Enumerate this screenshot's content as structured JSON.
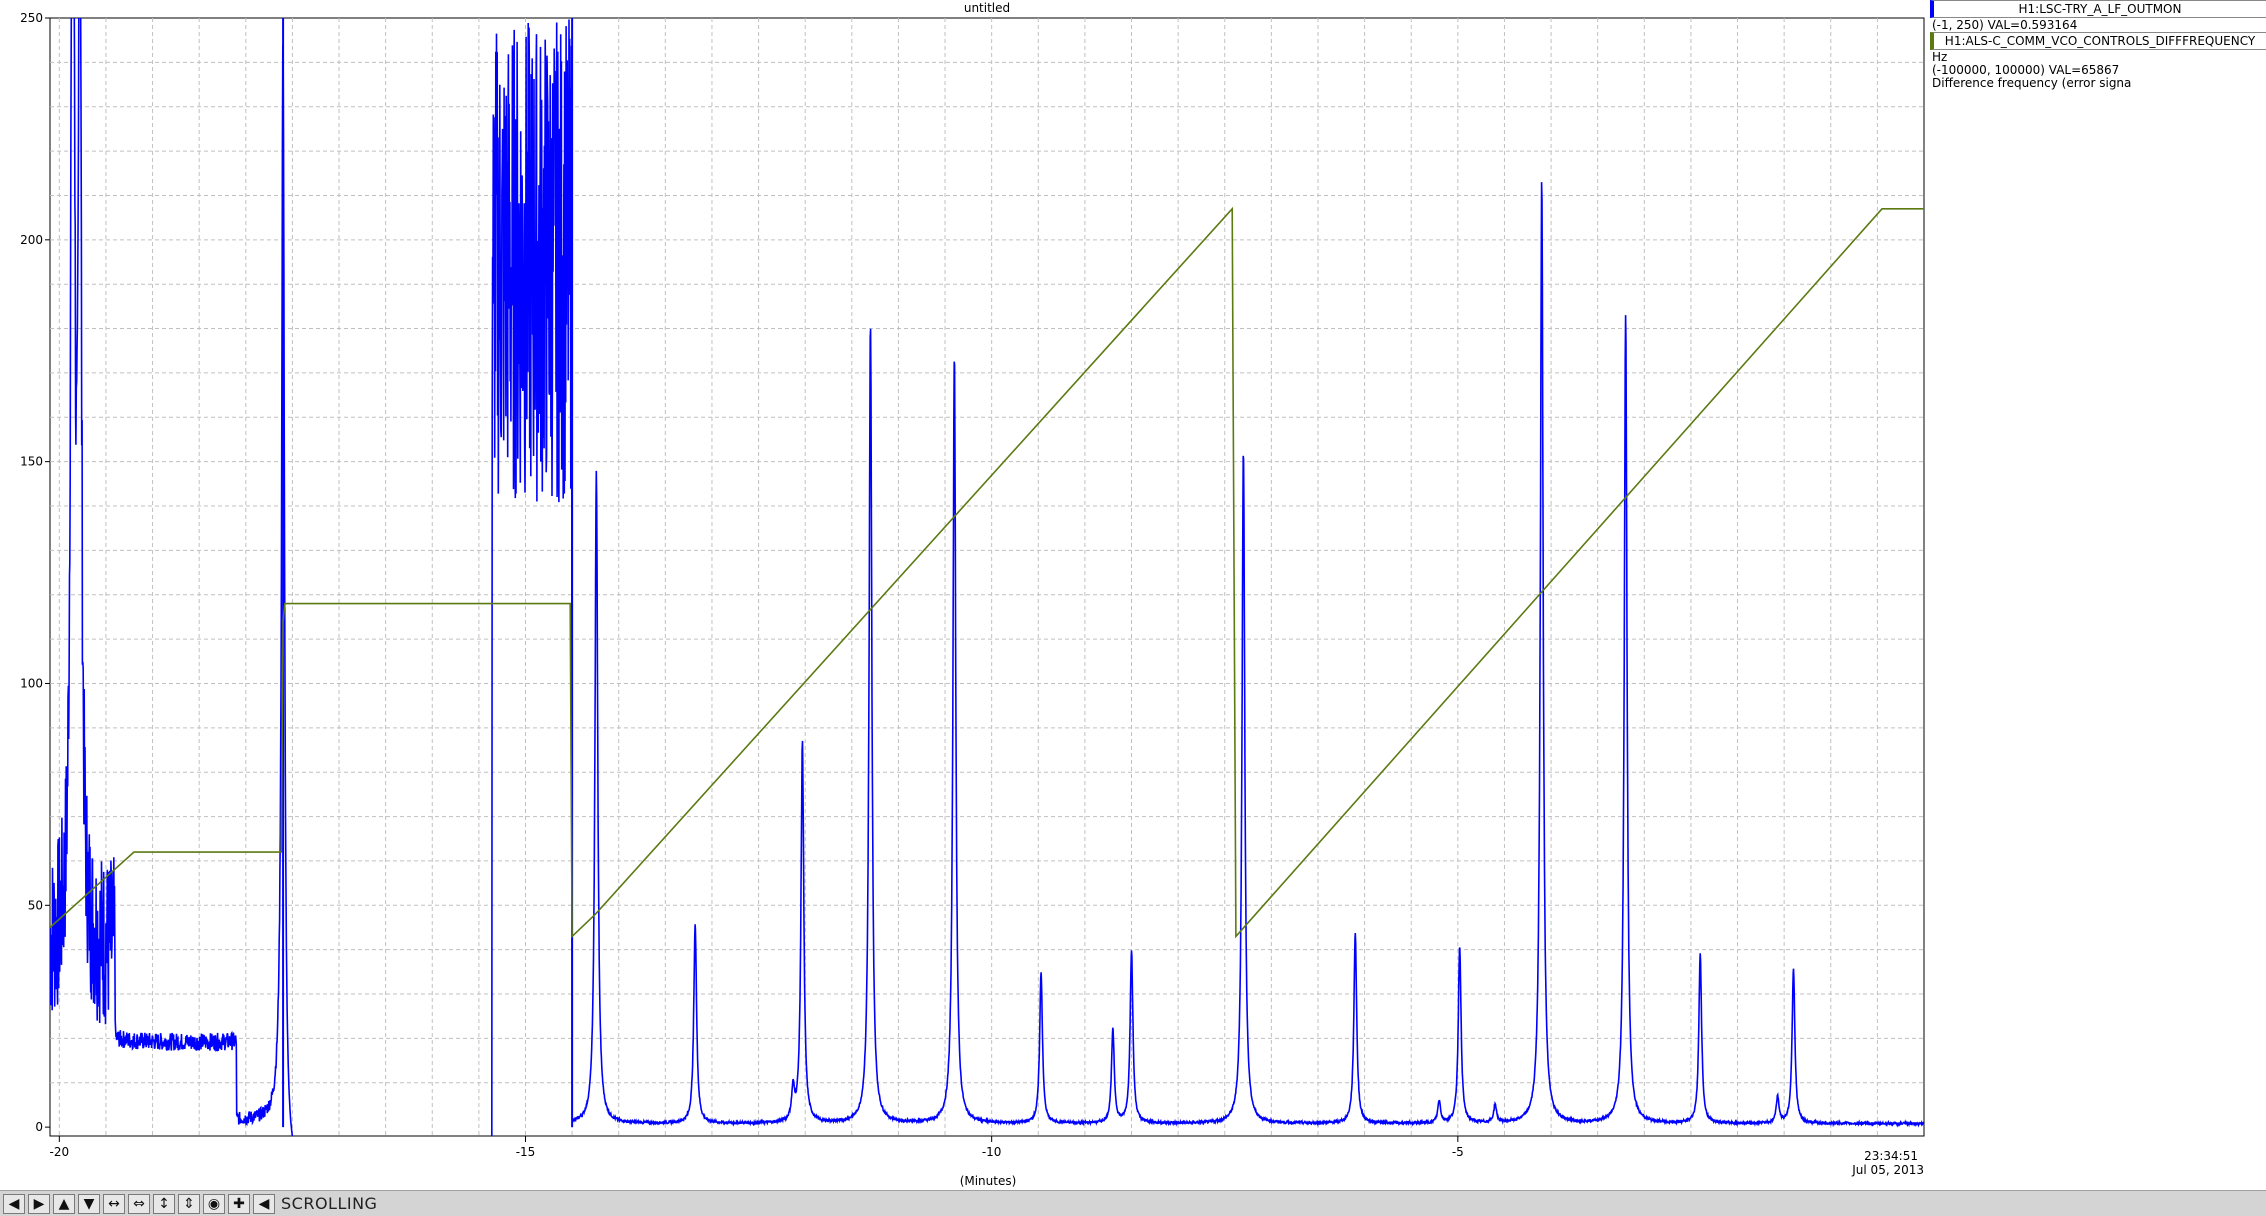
{
  "window_title": "untitled",
  "legend": {
    "series1_label": "H1:LSC-TRY_A_LF_OUTMON",
    "series1_range": "(-1, 250) VAL=0.593164",
    "series2_label": "H1:ALS-C_COMM_VCO_CONTROLS_DIFFFREQUENCY",
    "series2_unit": "Hz",
    "series2_range": "(-100000, 100000) VAL=65867",
    "series2_desc": "Difference frequency (error signa"
  },
  "timestamp": {
    "time": "23:34:51",
    "date": "Jul 05, 2013"
  },
  "toolbar": {
    "status": "SCROLLING",
    "icons": [
      "arrow-left-icon",
      "arrow-right-icon",
      "arrow-up-icon",
      "arrow-down-icon",
      "expand-horizontal-icon",
      "compress-horizontal-icon",
      "expand-vertical-icon",
      "compress-vertical-icon",
      "record-icon",
      "zoom-plus-icon",
      "back-icon"
    ]
  },
  "chart_data": {
    "type": "line",
    "title": "untitled",
    "xlabel": "(Minutes)",
    "ylabel": "",
    "xlim": [
      -20.1,
      0
    ],
    "ylim": [
      -2,
      250
    ],
    "x_ticks": [
      -20,
      -15,
      -10,
      -5
    ],
    "y_ticks": [
      0,
      50,
      100,
      150,
      200,
      250
    ],
    "grid": true,
    "colors": {
      "series1": "#0000ff",
      "series2": "#5c7a12",
      "grid": "#c0c0c0"
    },
    "series": [
      {
        "name": "H1:LSC-TRY_A_LF_OUTMON",
        "peaks": [
          {
            "x": -19.87,
            "y": 96
          },
          {
            "x": -19.85,
            "y": 250
          },
          {
            "x": -19.78,
            "y": 250
          },
          {
            "x": -17.6,
            "y": 250
          },
          {
            "x": -14.24,
            "y": 147
          },
          {
            "x": -13.18,
            "y": 45
          },
          {
            "x": -12.13,
            "y": 7
          },
          {
            "x": -12.03,
            "y": 86
          },
          {
            "x": -11.3,
            "y": 180
          },
          {
            "x": -10.4,
            "y": 173
          },
          {
            "x": -9.47,
            "y": 34
          },
          {
            "x": -8.7,
            "y": 21
          },
          {
            "x": -8.5,
            "y": 39
          },
          {
            "x": -7.3,
            "y": 152
          },
          {
            "x": -6.1,
            "y": 43
          },
          {
            "x": -5.2,
            "y": 5
          },
          {
            "x": -4.98,
            "y": 40
          },
          {
            "x": -4.6,
            "y": 4
          },
          {
            "x": -4.1,
            "y": 213
          },
          {
            "x": -3.2,
            "y": 182
          },
          {
            "x": -2.4,
            "y": 38
          },
          {
            "x": -1.57,
            "y": 6
          },
          {
            "x": -1.4,
            "y": 35
          }
        ],
        "segments": [
          {
            "x_start": -20.1,
            "x_end": -19.4,
            "level": 30,
            "note": "initial ringing"
          },
          {
            "x_start": -19.4,
            "x_end": -18.1,
            "level": 19
          },
          {
            "x_start": -18.1,
            "x_end": -17.6,
            "level": 1.5
          },
          {
            "x_start": -17.6,
            "x_end": -14.5,
            "level": 250,
            "note": "off-scale"
          },
          {
            "x_start": -15.36,
            "x_end": -14.5,
            "level": 200,
            "note": "noisy burst 140-250"
          },
          {
            "x_start": -14.5,
            "x_end": 0,
            "level": 0.8
          }
        ]
      },
      {
        "name": "H1:ALS-C_COMM_VCO_CONTROLS_DIFFFREQUENCY",
        "x": [
          -20.1,
          -19.2,
          -17.6,
          -17.6,
          -14.5,
          -14.5,
          -7.4,
          -7.35,
          0.0
        ],
        "points": [
          [
            -20.1,
            45
          ],
          [
            -19.2,
            62
          ],
          [
            -17.62,
            62
          ],
          [
            -17.6,
            114
          ],
          [
            -17.58,
            118
          ],
          [
            -14.52,
            118
          ],
          [
            -14.5,
            43
          ],
          [
            -14.25,
            48
          ],
          [
            -7.42,
            207
          ],
          [
            -7.38,
            43
          ],
          [
            -0.45,
            207
          ],
          [
            0,
            207
          ]
        ]
      }
    ]
  }
}
